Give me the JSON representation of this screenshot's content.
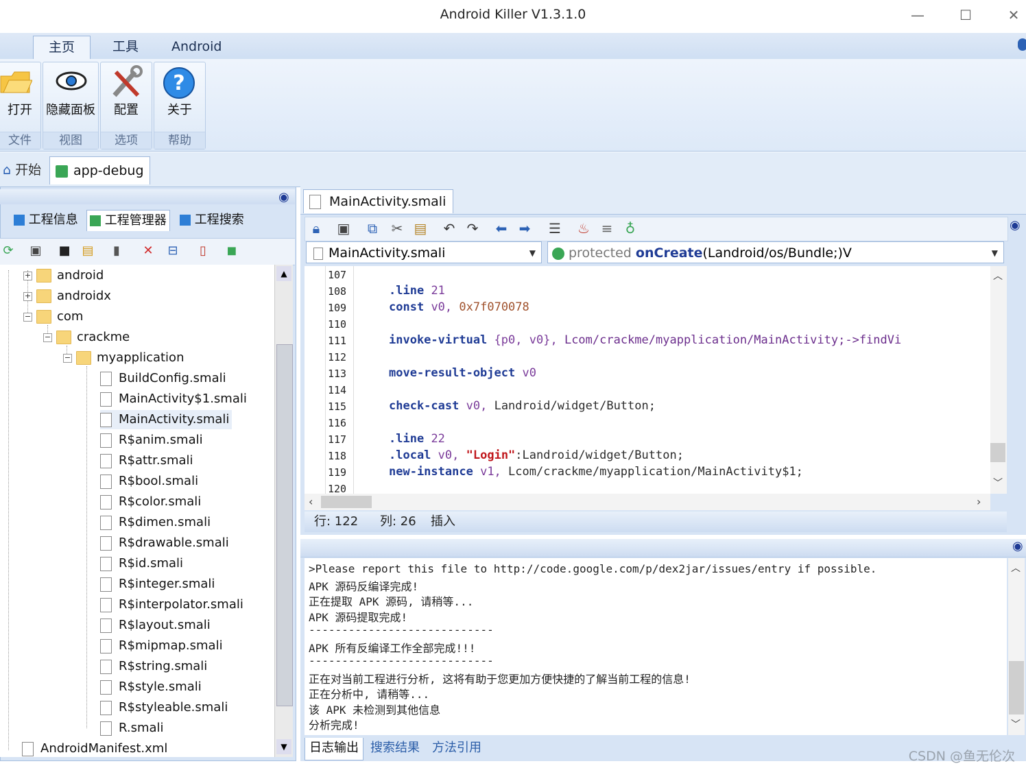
{
  "window": {
    "title": "Android Killer V1.3.1.0",
    "minimize": "—",
    "maximize": "☐",
    "close": "✕"
  },
  "ribbon": {
    "tabs": [
      "主页",
      "工具",
      "Android"
    ],
    "groups": [
      {
        "button": "打开",
        "group": "文件"
      },
      {
        "button": "隐藏面板",
        "group": "视图"
      },
      {
        "button": "配置",
        "group": "选项"
      },
      {
        "button": "关于",
        "group": "帮助"
      }
    ]
  },
  "doc_tabs": [
    "开始",
    "app-debug"
  ],
  "left_panel": {
    "tabs": [
      "工程信息",
      "工程管理器",
      "工程搜索"
    ],
    "tree": [
      {
        "label": "android",
        "type": "folder",
        "depth": 0,
        "expander": "+"
      },
      {
        "label": "androidx",
        "type": "folder",
        "depth": 0,
        "expander": "+"
      },
      {
        "label": "com",
        "type": "folder",
        "depth": 0,
        "expander": "−"
      },
      {
        "label": "crackme",
        "type": "folder",
        "depth": 1,
        "expander": "−"
      },
      {
        "label": "myapplication",
        "type": "folder",
        "depth": 2,
        "expander": "−"
      },
      {
        "label": "BuildConfig.smali",
        "type": "file",
        "depth": 3
      },
      {
        "label": "MainActivity$1.smali",
        "type": "file",
        "depth": 3
      },
      {
        "label": "MainActivity.smali",
        "type": "file",
        "depth": 3,
        "selected": true
      },
      {
        "label": "R$anim.smali",
        "type": "file",
        "depth": 3
      },
      {
        "label": "R$attr.smali",
        "type": "file",
        "depth": 3
      },
      {
        "label": "R$bool.smali",
        "type": "file",
        "depth": 3
      },
      {
        "label": "R$color.smali",
        "type": "file",
        "depth": 3
      },
      {
        "label": "R$dimen.smali",
        "type": "file",
        "depth": 3
      },
      {
        "label": "R$drawable.smali",
        "type": "file",
        "depth": 3
      },
      {
        "label": "R$id.smali",
        "type": "file",
        "depth": 3
      },
      {
        "label": "R$integer.smali",
        "type": "file",
        "depth": 3
      },
      {
        "label": "R$interpolator.smali",
        "type": "file",
        "depth": 3
      },
      {
        "label": "R$layout.smali",
        "type": "file",
        "depth": 3
      },
      {
        "label": "R$mipmap.smali",
        "type": "file",
        "depth": 3
      },
      {
        "label": "R$string.smali",
        "type": "file",
        "depth": 3
      },
      {
        "label": "R$style.smali",
        "type": "file",
        "depth": 3
      },
      {
        "label": "R$styleable.smali",
        "type": "file",
        "depth": 3
      },
      {
        "label": "R.smali",
        "type": "file",
        "depth": 3
      },
      {
        "label": "AndroidManifest.xml",
        "type": "file",
        "depth": -1
      }
    ]
  },
  "editor": {
    "tab": "MainActivity.smali",
    "file_combo": "MainActivity.smali",
    "method_combo": {
      "modifier": "protected",
      "name": "onCreate",
      "signature": "(Landroid/os/Bundle;)V"
    },
    "line_numbers": [
      "107",
      "108",
      "109",
      "110",
      "111",
      "112",
      "113",
      "114",
      "115",
      "116",
      "117",
      "118",
      "119",
      "120"
    ],
    "code": {
      "l108": [
        ".line",
        "21"
      ],
      "l109": [
        "const",
        "v0,",
        "0x7f070078"
      ],
      "l111": [
        "invoke-virtual",
        "{p0,",
        "v0},",
        "Lcom/crackme/myapplication/MainActivity;->findVi"
      ],
      "l113": [
        "move-result-object",
        "v0"
      ],
      "l115": [
        "check-cast",
        "v0,",
        "Landroid/widget/Button;"
      ],
      "l117": [
        ".line",
        "22"
      ],
      "l118": [
        ".local",
        "v0,",
        "\"Login\"",
        ":Landroid/widget/Button;"
      ],
      "l119": [
        "new-instance",
        "v1,",
        "Lcom/crackme/myapplication/MainActivity$1;"
      ]
    },
    "status": {
      "row": "行: 122",
      "col": "列: 26",
      "mode": "插入"
    }
  },
  "log": {
    "lines": [
      ">Please report this file to http://code.google.com/p/dex2jar/issues/entry if possible.",
      "APK 源码反编译完成!",
      "正在提取 APK 源码, 请稍等...",
      "APK 源码提取完成!",
      "----------------------------",
      "APK 所有反编译工作全部完成!!!",
      "----------------------------",
      "正在对当前工程进行分析, 这将有助于您更加方便快捷的了解当前工程的信息!",
      "正在分析中, 请稍等...",
      "该 APK 未检测到其他信息",
      "分析完成!"
    ],
    "tabs": [
      "日志输出",
      "搜索结果",
      "方法引用"
    ]
  },
  "watermark": "CSDN @鱼无伦次",
  "colors": {
    "ribbon_bg": "#dde9f8",
    "panel_bg": "#d7e4f5",
    "keyword": "#1f3b95",
    "string": "#c0161b",
    "link_tab": "#2b5da8"
  }
}
